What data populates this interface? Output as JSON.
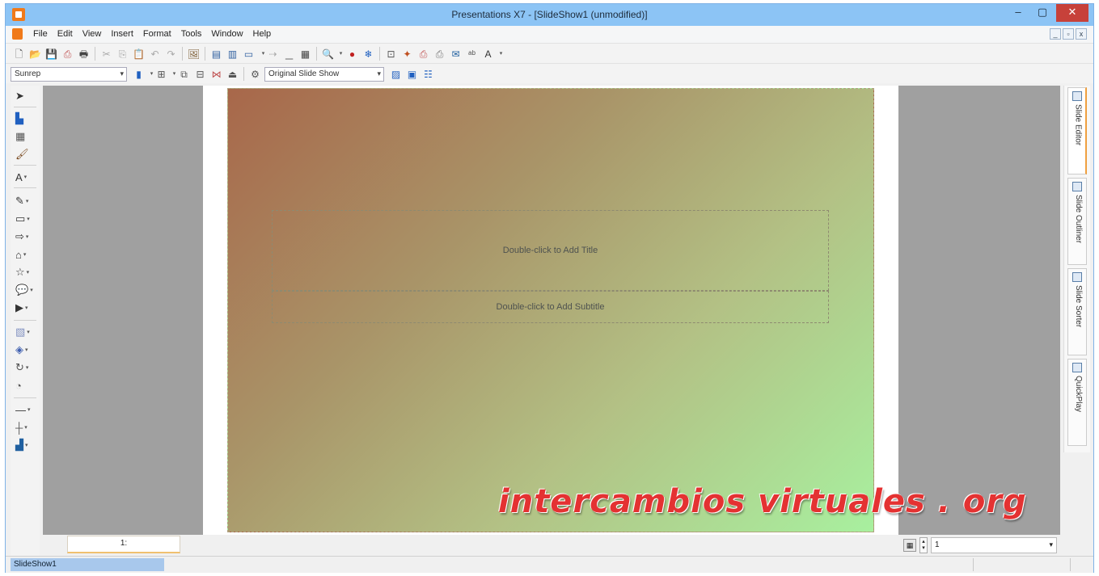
{
  "window": {
    "title": "Presentations X7 - [SlideShow1 (unmodified)]",
    "controls": [
      "–",
      "▢",
      "✕"
    ]
  },
  "menu": {
    "items": [
      "File",
      "Edit",
      "View",
      "Insert",
      "Format",
      "Tools",
      "Window",
      "Help"
    ],
    "mdi_controls": [
      "_",
      "▫",
      "x"
    ]
  },
  "toolbar2": {
    "font_combo": "Sunrep",
    "show_combo": "Original Slide Show"
  },
  "slide": {
    "title_placeholder": "Double-click to Add Title",
    "subtitle_placeholder": "Double-click to Add Subtitle"
  },
  "right_panel": {
    "tabs": [
      "Slide Editor",
      "Slide Outliner",
      "Slide Sorter",
      "QuickPlay"
    ]
  },
  "bottom": {
    "slide_tab": "1:",
    "slide_combo": "1"
  },
  "status": {
    "document": "SlideShow1"
  },
  "watermark": "intercambios virtuales . org",
  "colors": {
    "titlebar": "#8cc4f5",
    "close_button": "#c7413a",
    "gradient_start": "#a8674a",
    "gradient_end": "#a8f09f",
    "watermark": "#e43232"
  }
}
